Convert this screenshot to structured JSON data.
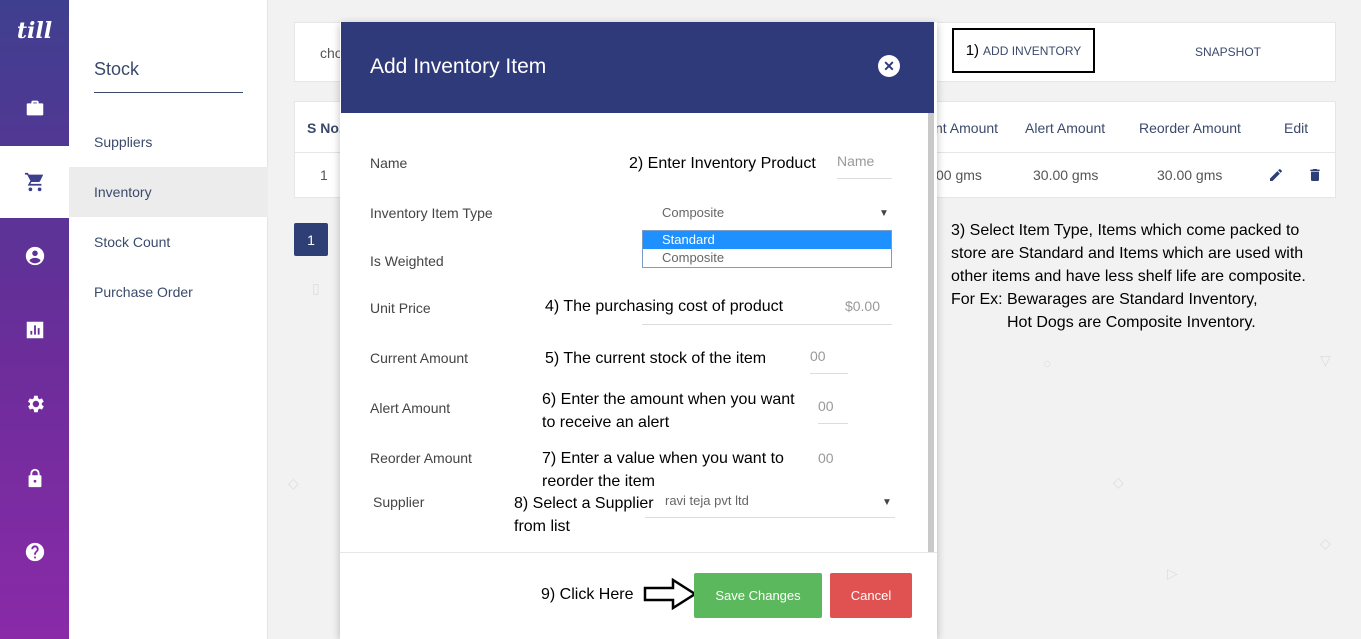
{
  "rail": {
    "logo": "till"
  },
  "sidebar": {
    "title": "Stock",
    "items": [
      {
        "label": "Suppliers"
      },
      {
        "label": "Inventory"
      },
      {
        "label": "Stock Count"
      },
      {
        "label": "Purchase Order"
      }
    ]
  },
  "topbar": {
    "chip": "cho",
    "add_number": "1)",
    "add_label": "ADD INVENTORY",
    "snapshot_label": "SNAPSHOT"
  },
  "table": {
    "headers": {
      "sno": "S No.",
      "current": "nt Amount",
      "alert": "Alert Amount",
      "reorder": "Reorder Amount",
      "edit": "Edit"
    },
    "row": {
      "sno": "1",
      "current": "00 gms",
      "alert": "30.00 gms",
      "reorder": "30.00 gms"
    }
  },
  "pagination": {
    "page": "1"
  },
  "note3": {
    "line1": "3) Select Item Type, Items which come packed to",
    "line2": "store are Standard and Items which are used with",
    "line3": "other items and have less shelf life are composite.",
    "line4": "For Ex: Bewarages are Standard Inventory,",
    "line5": "Hot Dogs are Composite  Inventory."
  },
  "modal": {
    "title": "Add Inventory Item",
    "close": "✕",
    "name_label": "Name",
    "name_placeholder": "Name",
    "name_annotation": "2) Enter Inventory Product",
    "type_label": "Inventory Item Type",
    "type_value": "Composite",
    "type_options": [
      "Standard",
      "Composite"
    ],
    "weighted_label": "Is Weighted",
    "unit_label": "Unit Price",
    "unit_placeholder": "$0.00",
    "unit_annotation": "4) The purchasing cost of product",
    "current_label": "Current Amount",
    "current_placeholder": "00",
    "current_annotation": "5) The current stock of the item",
    "alert_label": "Alert Amount",
    "alert_placeholder": "00",
    "alert_annotation_1": "6) Enter the amount when you want",
    "alert_annotation_2": "to receive an alert",
    "reorder_label": "Reorder Amount",
    "reorder_placeholder": "00",
    "reorder_annotation_1": "7) Enter a value when you want to",
    "reorder_annotation_2": "reorder the item",
    "supplier_label": "Supplier",
    "supplier_value": "ravi teja pvt ltd",
    "supplier_annotation_1": "8) Select a Supplier",
    "supplier_annotation_2": "from list",
    "click_annotation": "9) Click Here",
    "save_label": "Save Changes",
    "cancel_label": "Cancel"
  }
}
